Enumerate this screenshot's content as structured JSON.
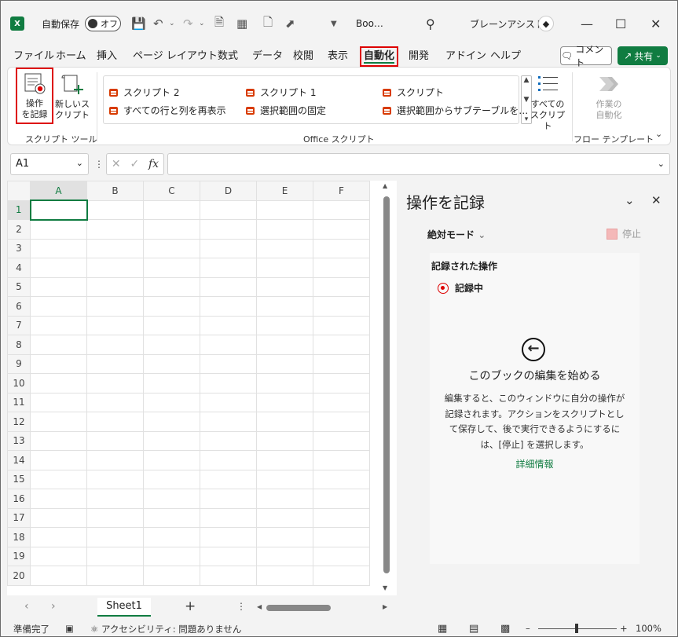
{
  "titlebar": {
    "app_logo": "X",
    "autosave_label": "自動保存",
    "autosave_state": "オフ",
    "doc_title": "Boo…",
    "assistant_name": "ブレーンアシスト",
    "icons": [
      "save-icon",
      "undo-icon",
      "redo-icon",
      "print-preview-icon",
      "table-icon",
      "new-file-icon",
      "pointer-icon",
      "customize-qat-icon",
      "search-icon"
    ]
  },
  "tabs": [
    "ファイル",
    "ホーム",
    "挿入",
    "ページ レイアウト",
    "数式",
    "データ",
    "校閲",
    "表示",
    "自動化",
    "開発",
    "アドイン",
    "ヘルプ"
  ],
  "active_tab": "自動化",
  "header_buttons": {
    "comment": "コメント",
    "share": "共有"
  },
  "ribbon": {
    "record_label_1": "操作",
    "record_label_2": "を記録",
    "new_script_1": "新しいス",
    "new_script_2": "クリプト",
    "group_script_tools": "スクリプト ツール",
    "scripts": [
      "スクリプト 2",
      "スクリプト 1",
      "スクリプト",
      "すべての行と列を再表示",
      "選択範囲の固定",
      "選択範囲からサブテーブルを…"
    ],
    "group_office_scripts": "Office スクリプト",
    "all_scripts_1": "すべての",
    "all_scripts_2": "スクリプト",
    "automate_work_1": "作業の",
    "automate_work_2": "自動化",
    "group_flow": "フロー テンプレート"
  },
  "formula_bar": {
    "name_box": "A1",
    "fx": "fx",
    "value": ""
  },
  "grid": {
    "columns": [
      "A",
      "B",
      "C",
      "D",
      "E",
      "F"
    ],
    "rows": [
      "1",
      "2",
      "3",
      "4",
      "5",
      "6",
      "7",
      "8",
      "9",
      "10",
      "11",
      "12",
      "13",
      "14",
      "15",
      "16",
      "17",
      "18",
      "19",
      "20"
    ],
    "active_cell": "A1"
  },
  "sheets": [
    "Sheet1"
  ],
  "pane": {
    "title": "操作を記録",
    "mode": "絶対モード",
    "stop": "停止",
    "recorded_heading": "記録された操作",
    "recording": "記録中",
    "start_title": "このブックの編集を始める",
    "start_desc_1": "編集すると、このウィンドウに自分の操作が",
    "start_desc_2": "記録されます。アクションをスクリプトとし",
    "start_desc_3": "て保存して、後で実行できるようにするに",
    "start_desc_4": "は、[停止] を選択します。",
    "learn_more": "詳細情報"
  },
  "status": {
    "ready": "準備完了",
    "accessibility": "アクセシビリティ: 問題ありません",
    "zoom": "100%"
  },
  "colors": {
    "accent": "#107c41",
    "highlight": "#dd0000",
    "script_icon": "#d83b01"
  }
}
